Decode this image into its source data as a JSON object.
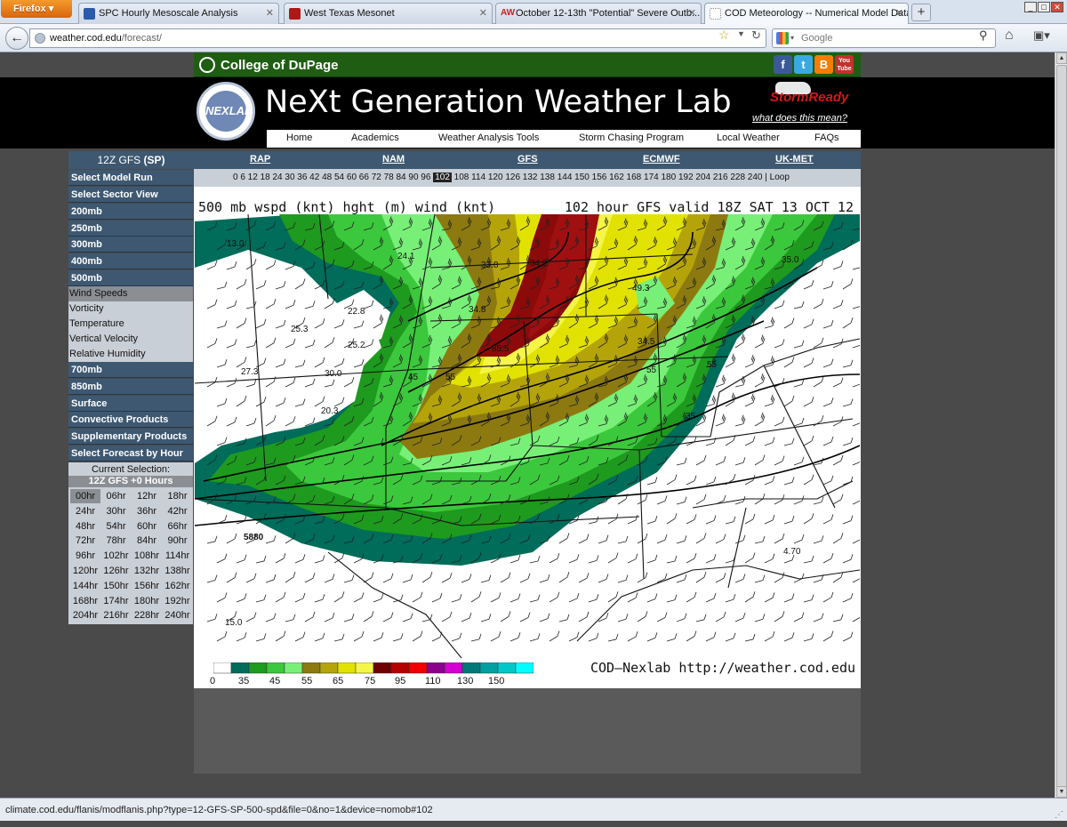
{
  "browser": {
    "app_button": "Firefox",
    "tabs": [
      {
        "label": "SPC Hourly Mesoscale Analysis",
        "color": "#2a5aa8"
      },
      {
        "label": "West Texas Mesonet",
        "color": "#b01818"
      },
      {
        "label": "October 12-13th \"Potential\" Severe Outb...",
        "color": "#cc2222",
        "prefix": "AW"
      },
      {
        "label": "COD Meteorology -- Numerical Model Data",
        "color": "#ffffff",
        "active": true
      }
    ],
    "url_domain": "weather.cod.edu",
    "url_path": "/forecast/",
    "search_placeholder": "Google",
    "status_url": "climate.cod.edu/flanis/modflanis.php?type=12-GFS-SP-500-spd&file=0&no=1&device=nomob#102"
  },
  "header": {
    "college": "College of DuPage",
    "social": [
      "f",
      "t",
      "B",
      "You Tube"
    ],
    "lab_logo": "NEXLAB",
    "lab_title": "NeXt Generation Weather Lab",
    "storm_ready": "StormReady",
    "storm_ready_link": "what does this mean?",
    "nav": [
      "Home",
      "Academics",
      "Weather Analysis Tools",
      "Storm Chasing Program",
      "Local Weather",
      "FAQs"
    ]
  },
  "model": {
    "current_label": "12Z GFS ",
    "current_sector": "(SP)",
    "models": [
      "RAP",
      "NAM",
      "GFS",
      "ECMWF",
      "UK-MET"
    ],
    "hours_before": "0 6 12 18 24 30 36 42 48 54 60 66 72 78 84 90 96",
    "selected_hour": "102",
    "hours_after": "108 114 120 126 132 138 144 150 156 162 168 174 180 192 204 216 228 240 | Loop"
  },
  "sidebar": {
    "buttons_top": [
      "Select Model Run",
      "Select Sector View",
      "200mb",
      "250mb",
      "300mb",
      "400mb",
      "500mb"
    ],
    "sub_items": [
      "Wind Speeds",
      "Vorticity",
      "Temperature",
      "Vertical Velocity",
      "Relative Humidity"
    ],
    "selected_sub": "Wind Speeds",
    "buttons_bottom": [
      "700mb",
      "850mb",
      "Surface",
      "Convective Products",
      "Supplementary Products",
      "Select Forecast by Hour"
    ],
    "current_selection_label": "Current Selection:",
    "current_selection_value": "12Z GFS +0 Hours",
    "hour_cells": [
      "00hr",
      "06hr",
      "12hr",
      "18hr",
      "24hr",
      "30hr",
      "36hr",
      "42hr",
      "48hr",
      "54hr",
      "60hr",
      "66hr",
      "72hr",
      "78hr",
      "84hr",
      "90hr",
      "96hr",
      "102hr",
      "108hr",
      "114hr",
      "120hr",
      "126hr",
      "132hr",
      "138hr",
      "144hr",
      "150hr",
      "156hr",
      "162hr",
      "168hr",
      "174hr",
      "180hr",
      "192hr",
      "204hr",
      "216hr",
      "228hr",
      "240hr"
    ],
    "selected_hour_cell": "00hr"
  },
  "map": {
    "title_left": "500 mb wspd (knt) hght (m) wind (knt)",
    "title_right": "102 hour GFS valid 18Z SAT 13 OCT 12",
    "credit": "COD—Nexlab http://weather.cod.edu",
    "labels": [
      "13.0",
      "24.1",
      "33.8",
      "34.2",
      "34.8",
      "22.8",
      "25.3",
      "25.2",
      "27.3",
      "30.0",
      "45",
      "55",
      "49.3",
      "34.5",
      "55",
      "55",
      "35.0",
      "20.3",
      "35",
      "5880",
      "4.70",
      "15.0",
      "85.5"
    ],
    "colorbar": {
      "colors": [
        "#ffffff",
        "#006c5a",
        "#1e9a1e",
        "#3cc83c",
        "#78f078",
        "#8c7a10",
        "#b4a40a",
        "#e2e200",
        "#f5f548",
        "#6e0000",
        "#b40000",
        "#f00000",
        "#8c008c",
        "#d200d2",
        "#007878",
        "#00a0a0",
        "#00c8c8",
        "#00ffff"
      ],
      "tick_labels": [
        "0",
        "35",
        "45",
        "55",
        "65",
        "75",
        "95",
        "110",
        "130",
        "150"
      ]
    }
  }
}
